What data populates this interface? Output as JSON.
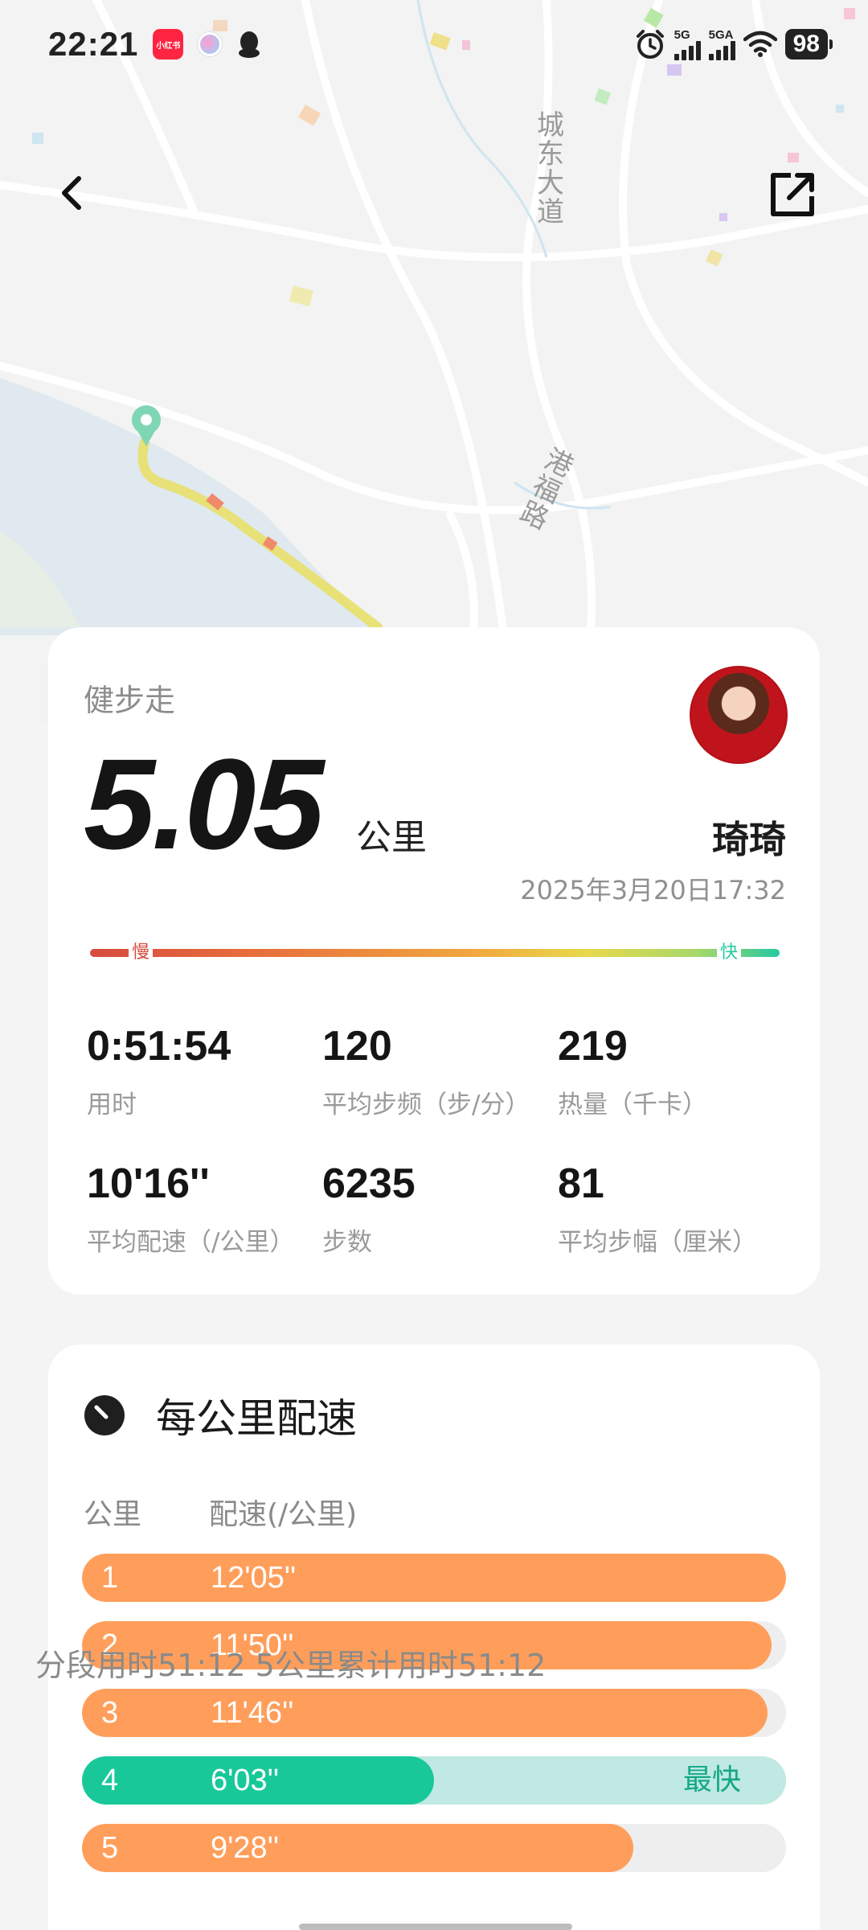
{
  "status_bar": {
    "time": "22:21",
    "app_badge": "小红书",
    "signal1_label": "5G",
    "signal2_label": "5GA",
    "battery": "98"
  },
  "map": {
    "road1": [
      "城",
      "东",
      "大",
      "道"
    ],
    "road2": [
      "港",
      "福",
      "路"
    ]
  },
  "summary": {
    "sport_type": "健步走",
    "distance": "5.05",
    "distance_unit": "公里",
    "user_name": "琦琦",
    "datetime": "2025年3月20日17:32",
    "pace_scale": {
      "slow": "慢",
      "fast": "快"
    },
    "stats": [
      {
        "value": "0:51:54",
        "label": "用时"
      },
      {
        "value": "120",
        "label": "平均步频（步/分）"
      },
      {
        "value": "219",
        "label": "热量（千卡）"
      },
      {
        "value": "10'16''",
        "label": "平均配速（/公里）"
      },
      {
        "value": "6235",
        "label": "步数"
      },
      {
        "value": "81",
        "label": "平均步幅（厘米）"
      }
    ]
  },
  "pace_section": {
    "title": "每公里配速",
    "col_km": "公里",
    "col_pace": "配速(/公里)",
    "fastest_label": "最快",
    "splits": [
      {
        "km": "1",
        "pace": "12'05''",
        "fraction": 1.0,
        "fastest": false
      },
      {
        "km": "2",
        "pace": "11'50''",
        "fraction": 0.979,
        "fastest": false
      },
      {
        "km": "3",
        "pace": "11'46''",
        "fraction": 0.974,
        "fastest": false
      },
      {
        "km": "4",
        "pace": "6'03''",
        "fraction": 0.5,
        "fastest": true
      },
      {
        "km": "5",
        "pace": "9'28''",
        "fraction": 0.783,
        "fastest": false
      }
    ],
    "footer": "分段用时51:12        5公里累计用时51:12"
  },
  "colors": {
    "split_bar": "#ff9e5b",
    "fastest_bar": "#18c899",
    "fastest_track": "#bfe9e2"
  }
}
